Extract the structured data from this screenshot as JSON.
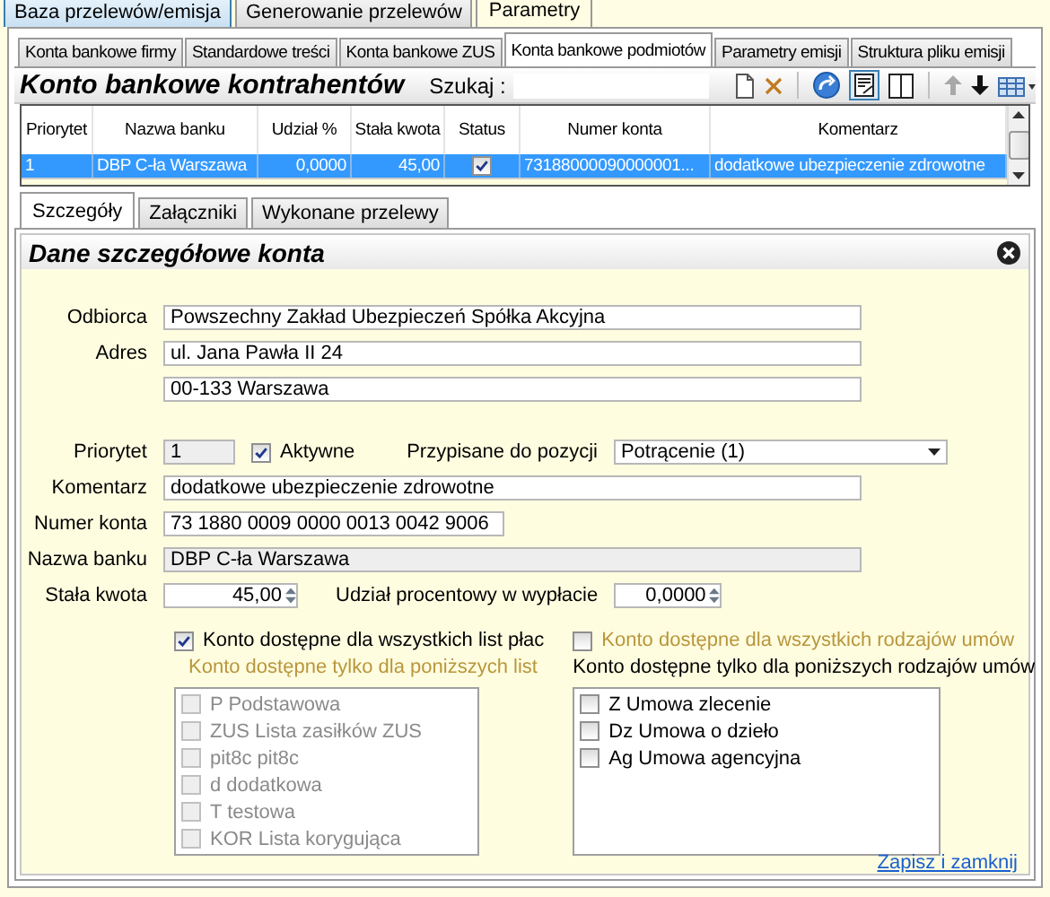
{
  "top_tabs": [
    {
      "label": "Baza przelewów/emisja",
      "selected": false
    },
    {
      "label": "Generowanie przelewów",
      "selected": false
    },
    {
      "label": "Parametry",
      "selected": true
    }
  ],
  "sub_tabs": [
    {
      "label": "Konta bankowe firmy",
      "selected": false
    },
    {
      "label": "Standardowe treści",
      "selected": false
    },
    {
      "label": "Konta bankowe ZUS",
      "selected": false
    },
    {
      "label": "Konta bankowe podmiotów",
      "selected": true
    },
    {
      "label": "Parametry emisji",
      "selected": false
    },
    {
      "label": "Struktura pliku emisji",
      "selected": false
    }
  ],
  "list_panel": {
    "title": "Konto bankowe kontrahentów",
    "search_label": "Szukaj :"
  },
  "table": {
    "columns": [
      "Priorytet",
      "Nazwa banku",
      "Udział %",
      "Stała kwota",
      "Status",
      "Numer konta",
      "Komentarz"
    ],
    "rows": [
      {
        "priorytet": "1",
        "bank": "DBP C-ła Warszawa",
        "udzial": "0,0000",
        "kwota": "45,00",
        "status": true,
        "numer": "73188000090000001...",
        "komentarz": "dodatkowe ubezpieczenie zdrowotne",
        "selected": true
      }
    ]
  },
  "detail_tabs": [
    {
      "label": "Szczegóły",
      "selected": true
    },
    {
      "label": "Załączniki",
      "selected": false
    },
    {
      "label": "Wykonane przelewy",
      "selected": false
    }
  ],
  "detail": {
    "title": "Dane szczegółowe konta",
    "odbiorca": {
      "label": "Odbiorca",
      "value": "Powszechny Zakład Ubezpieczeń Spółka Akcyjna"
    },
    "adres": {
      "label": "Adres",
      "lines": [
        "ul. Jana Pawła II 24",
        "00-133 Warszawa"
      ]
    },
    "priorytet": {
      "label": "Priorytet",
      "value": "1"
    },
    "aktywne": {
      "label": "Aktywne",
      "checked": true
    },
    "pozycja": {
      "label": "Przypisane do pozycji",
      "value": "Potrącenie (1)"
    },
    "komentarz": {
      "label": "Komentarz",
      "value": "dodatkowe ubezpieczenie zdrowotne"
    },
    "numer": {
      "label": "Numer konta",
      "value": "73 1880 0009 0000 0013 0042 9006"
    },
    "bank": {
      "label": "Nazwa banku",
      "value": "DBP C-ła Warszawa"
    },
    "kwota": {
      "label": "Stała kwota",
      "value": "45,00"
    },
    "udzial": {
      "label": "Udział procentowy w wypłacie",
      "value": "0,0000"
    },
    "lists": {
      "all_label": "Konto dostępne dla wszystkich list płac",
      "all_checked": true,
      "only_label": "Konto dostępne tylko dla poniższych list",
      "items": [
        {
          "label": "P Podstawowa",
          "checked": false
        },
        {
          "label": "ZUS Lista zasiłków ZUS",
          "checked": false
        },
        {
          "label": "pit8c pit8c",
          "checked": false
        },
        {
          "label": "d dodatkowa",
          "checked": false
        },
        {
          "label": "T testowa",
          "checked": false
        },
        {
          "label": "KOR Lista korygująca",
          "checked": false
        }
      ]
    },
    "umowy": {
      "all_label": "Konto dostępne dla wszystkich rodzajów umów",
      "all_checked": false,
      "only_label": "Konto dostępne tylko dla poniższych rodzajów umów",
      "items": [
        {
          "label": "Z Umowa zlecenie",
          "checked": false
        },
        {
          "label": "Dz Umowa o dzieło",
          "checked": false
        },
        {
          "label": "Ag Umowa agencyjna",
          "checked": false
        }
      ]
    },
    "save_link": "Zapisz i zamknij"
  }
}
